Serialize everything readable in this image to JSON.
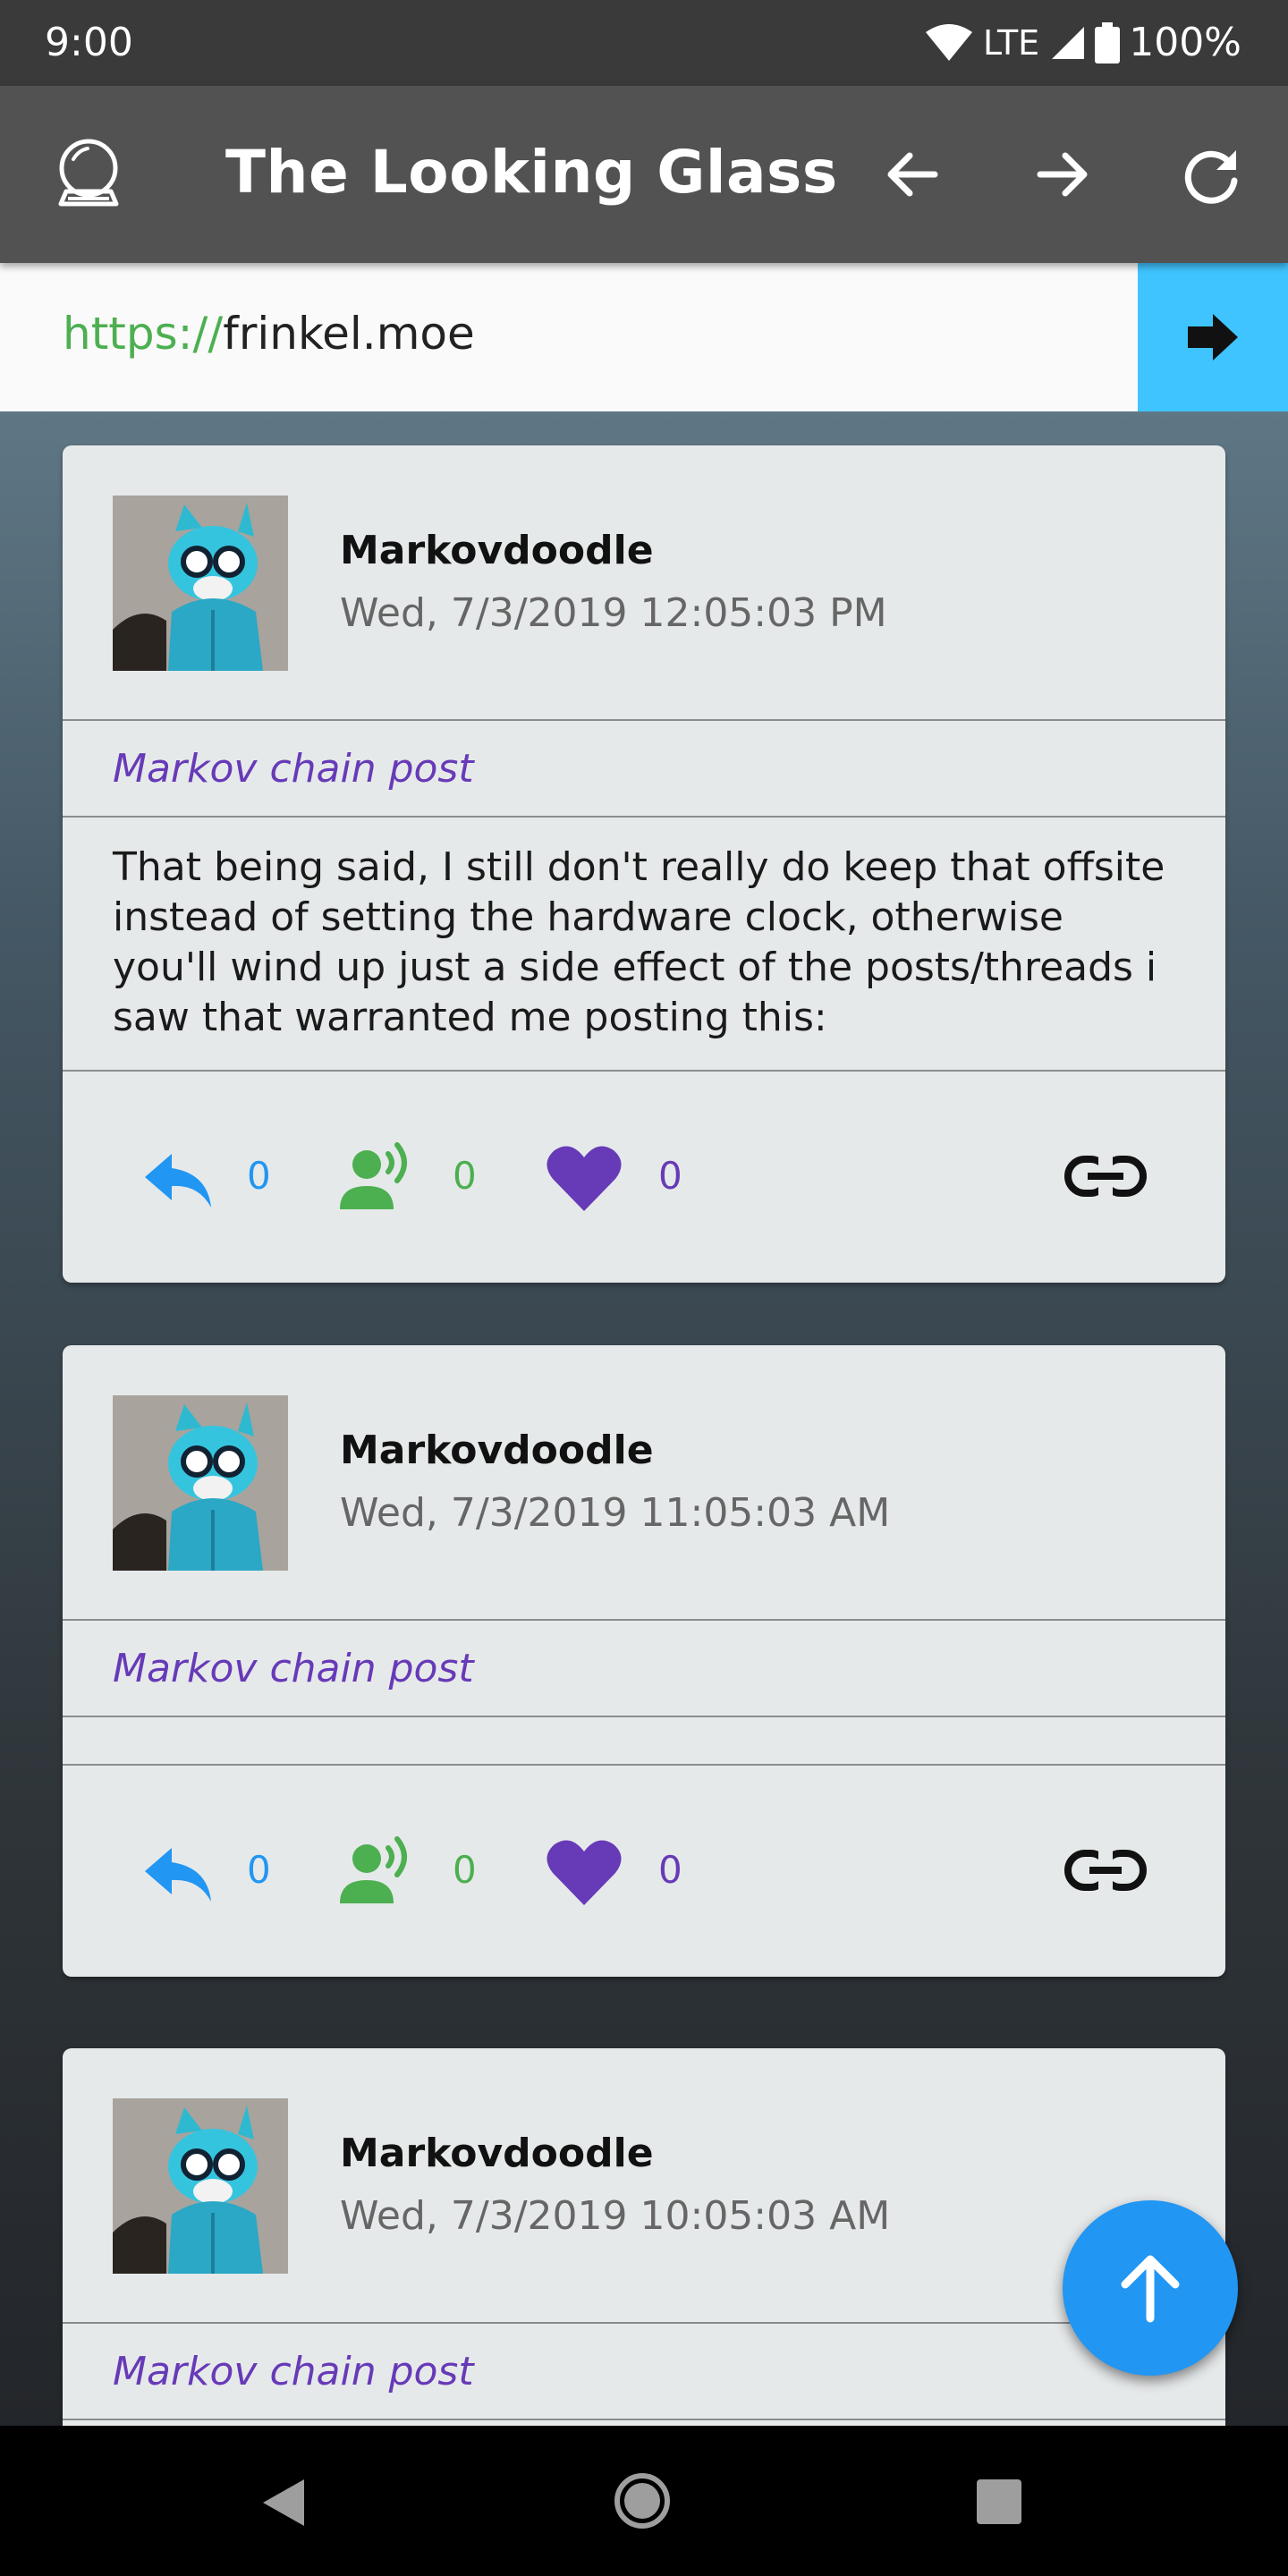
{
  "status_bar": {
    "time": "9:00",
    "network": "LTE",
    "battery": "100%"
  },
  "app_bar": {
    "title": "The Looking Glass",
    "icons": [
      "crystal-ball-icon",
      "arrow-back-icon",
      "arrow-forward-icon",
      "refresh-icon"
    ]
  },
  "url_bar": {
    "scheme": "https://",
    "host": "frinkel.moe",
    "go_icon": "arrow-right-icon"
  },
  "colors": {
    "reply": "#2196f3",
    "boost": "#4caf50",
    "like": "#673ab7",
    "url_scheme": "#4caf50",
    "go_button": "#40c4ff",
    "fab": "#2196f3"
  },
  "posts": [
    {
      "author": "Markovdoodle",
      "timestamp": "Wed, 7/3/2019 12:05:03 PM",
      "type": "Markov chain post",
      "body": "That being said, I still don't really do keep that offsite instead of setting the hardware clock, otherwise you'll wind up just a side effect of the posts/threads i saw that warranted me posting this:",
      "replies": "0",
      "boosts": "0",
      "likes": "0"
    },
    {
      "author": "Markovdoodle",
      "timestamp": "Wed, 7/3/2019 11:05:03 AM",
      "type": "Markov chain post",
      "body": "",
      "replies": "0",
      "boosts": "0",
      "likes": "0"
    },
    {
      "author": "Markovdoodle",
      "timestamp": "Wed, 7/3/2019 10:05:03 AM",
      "type": "Markov chain post"
    }
  ],
  "fab": {
    "icon": "arrow-up-icon"
  },
  "nav_bar": {
    "icons": [
      "back-triangle-icon",
      "home-circle-icon",
      "recents-square-icon"
    ]
  }
}
